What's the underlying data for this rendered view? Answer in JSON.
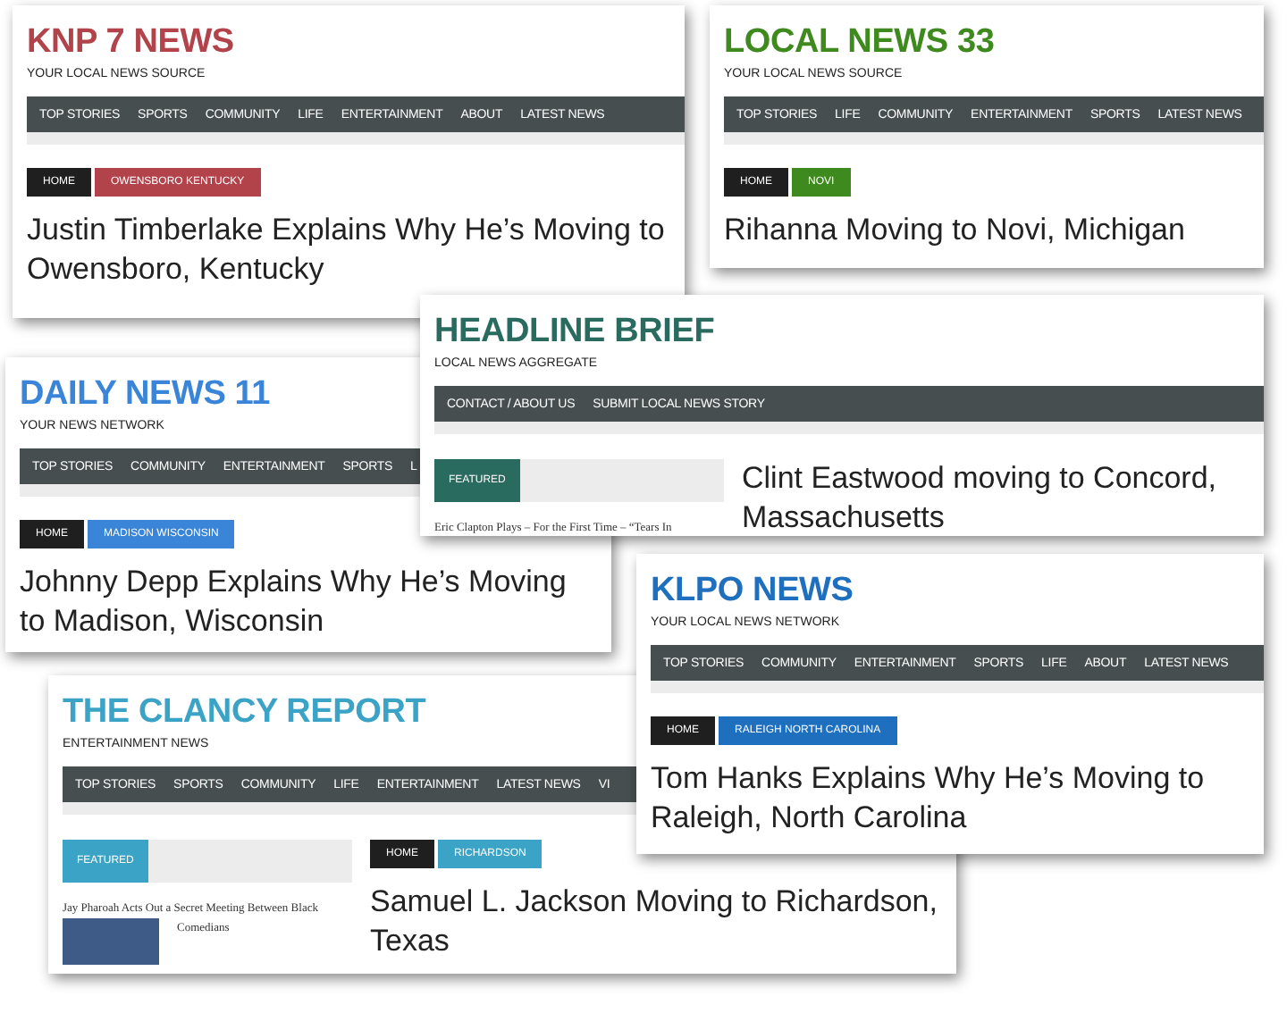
{
  "sites": [
    {
      "title": "KNP 7 NEWS",
      "tagline": "YOUR LOCAL NEWS SOURCE",
      "color": "#b3434b",
      "nav": [
        "TOP STORIES",
        "SPORTS",
        "COMMUNITY",
        "LIFE",
        "ENTERTAINMENT",
        "ABOUT",
        "LATEST NEWS"
      ],
      "breadcrumbs": [
        {
          "label": "HOME",
          "kind": "home"
        },
        {
          "label": "OWENSBORO KENTUCKY",
          "kind": "category"
        }
      ],
      "headline": "Justin Timberlake Explains Why He’s Moving to Owensboro, Kentucky"
    },
    {
      "title": "LOCAL NEWS 33",
      "tagline": "YOUR LOCAL NEWS SOURCE",
      "color": "#3f8a1e",
      "nav": [
        "TOP STORIES",
        "LIFE",
        "COMMUNITY",
        "ENTERTAINMENT",
        "SPORTS",
        "LATEST NEWS"
      ],
      "breadcrumbs": [
        {
          "label": "HOME",
          "kind": "home"
        },
        {
          "label": "NOVI",
          "kind": "category"
        }
      ],
      "headline": "Rihanna Moving to Novi, Michigan"
    },
    {
      "title": "HEADLINE BRIEF",
      "tagline": "LOCAL NEWS AGGREGATE",
      "color": "#2a6b5f",
      "nav": [
        "CONTACT / ABOUT US",
        "SUBMIT LOCAL NEWS STORY"
      ],
      "featured": {
        "label": "FEATURED",
        "story": "Eric Clapton Plays – For the First Time – “Tears In"
      },
      "headline": "Clint Eastwood moving to Concord, Massachusetts"
    },
    {
      "title": "DAILY NEWS 11",
      "tagline": "YOUR NEWS NETWORK",
      "color": "#3a85d8",
      "nav": [
        "TOP STORIES",
        "COMMUNITY",
        "ENTERTAINMENT",
        "SPORTS",
        "L"
      ],
      "breadcrumbs": [
        {
          "label": "HOME",
          "kind": "home"
        },
        {
          "label": "MADISON WISCONSIN",
          "kind": "category"
        }
      ],
      "headline": "Johnny Depp Explains Why He’s Moving to Madison, Wisconsin"
    },
    {
      "title": "KLPO NEWS",
      "tagline": "YOUR LOCAL NEWS NETWORK",
      "color": "#1f6fbf",
      "nav": [
        "TOP STORIES",
        "COMMUNITY",
        "ENTERTAINMENT",
        "SPORTS",
        "LIFE",
        "ABOUT",
        "LATEST NEWS"
      ],
      "breadcrumbs": [
        {
          "label": "HOME",
          "kind": "home"
        },
        {
          "label": "RALEIGH NORTH CAROLINA",
          "kind": "category"
        }
      ],
      "headline": "Tom Hanks Explains Why He’s Moving to Raleigh, North Carolina"
    },
    {
      "title": "THE CLANCY REPORT",
      "tagline": "ENTERTAINMENT NEWS",
      "color": "#3ba3c6",
      "nav": [
        "TOP STORIES",
        "SPORTS",
        "COMMUNITY",
        "LIFE",
        "ENTERTAINMENT",
        "LATEST NEWS",
        "VI"
      ],
      "featured": {
        "label": "FEATURED",
        "story": "Jay Pharoah Acts Out a Secret Meeting Between Black Comedians",
        "photo": true
      },
      "breadcrumbs": [
        {
          "label": "HOME",
          "kind": "home"
        },
        {
          "label": "RICHARDSON",
          "kind": "category"
        }
      ],
      "headline": "Samuel L. Jackson Moving to Richardson, Texas"
    }
  ]
}
